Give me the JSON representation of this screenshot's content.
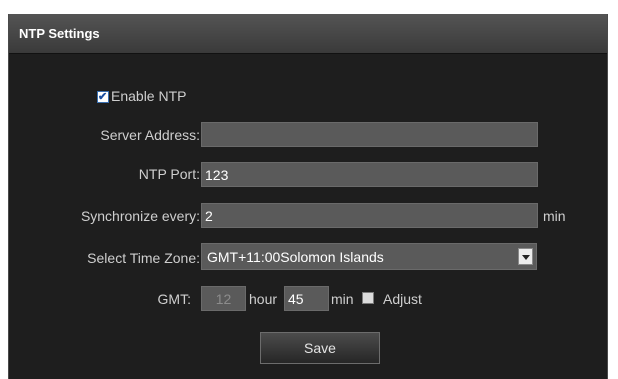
{
  "panel": {
    "title": "NTP Settings"
  },
  "enable_ntp": {
    "label": "Enable NTP",
    "checked": true
  },
  "server_address": {
    "label": "Server Address:",
    "value": ""
  },
  "ntp_port": {
    "label": "NTP Port:",
    "value": "123"
  },
  "sync": {
    "label": "Synchronize every:",
    "value": "2",
    "unit": "min"
  },
  "timezone": {
    "label": "Select Time Zone:",
    "value": "GMT+11:00Solomon Islands"
  },
  "gmt": {
    "label": "GMT:",
    "hour_value": "12",
    "hour_unit": "hour",
    "min_value": "45",
    "min_unit": "min",
    "adjust_label": "Adjust",
    "adjust_checked": false
  },
  "save_label": "Save",
  "colors": {
    "panel_bg": "#1e1e1e",
    "field_bg": "#5a5a5a",
    "label_text": "#cfcfcf"
  }
}
